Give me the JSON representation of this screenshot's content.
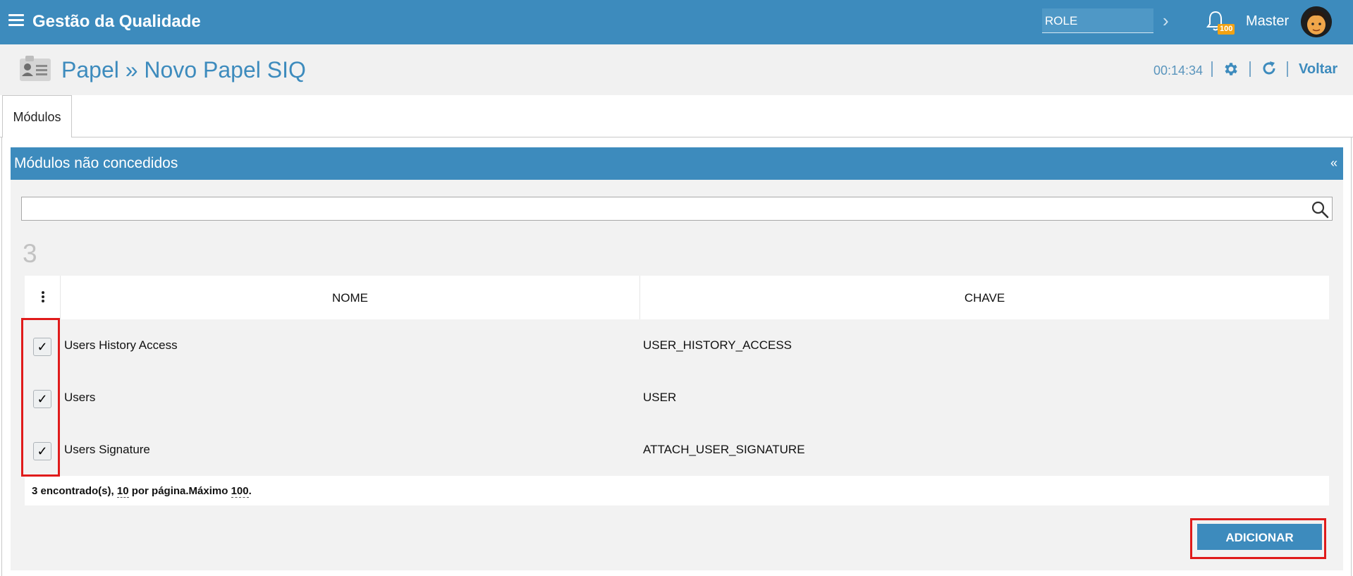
{
  "app": {
    "title": "Gestão da Qualidade"
  },
  "topbar": {
    "role_value": "ROLE",
    "notification_count": "100",
    "user_name": "Master"
  },
  "header": {
    "title": "Papel » Novo Papel SIQ",
    "timer": "00:14:34",
    "back_label": "Voltar"
  },
  "tabs": [
    {
      "label": "Módulos"
    }
  ],
  "panel": {
    "title": "Módulos não concedidos",
    "collapse_label": "«"
  },
  "search": {
    "value": "",
    "placeholder": ""
  },
  "result_count": "3",
  "table": {
    "columns": [
      "NOME",
      "CHAVE"
    ],
    "rows": [
      {
        "nome": "Users History Access",
        "chave": "USER_HISTORY_ACCESS",
        "checked": true,
        "check": "✓"
      },
      {
        "nome": "Users",
        "chave": "USER",
        "checked": true,
        "check": "✓"
      },
      {
        "nome": "Users Signature",
        "chave": "ATTACH_USER_SIGNATURE",
        "checked": true,
        "check": "✓"
      }
    ]
  },
  "pager": {
    "found": "3 encontrado(s), ",
    "per_page_value": "10",
    "per_page_label": " por página.Máximo ",
    "max_value": "100",
    "end": "."
  },
  "actions": {
    "add_label": "ADICIONAR"
  },
  "colors": {
    "primary": "#3d8bbd",
    "badge": "#f2a213",
    "highlight": "#e01b1b"
  }
}
